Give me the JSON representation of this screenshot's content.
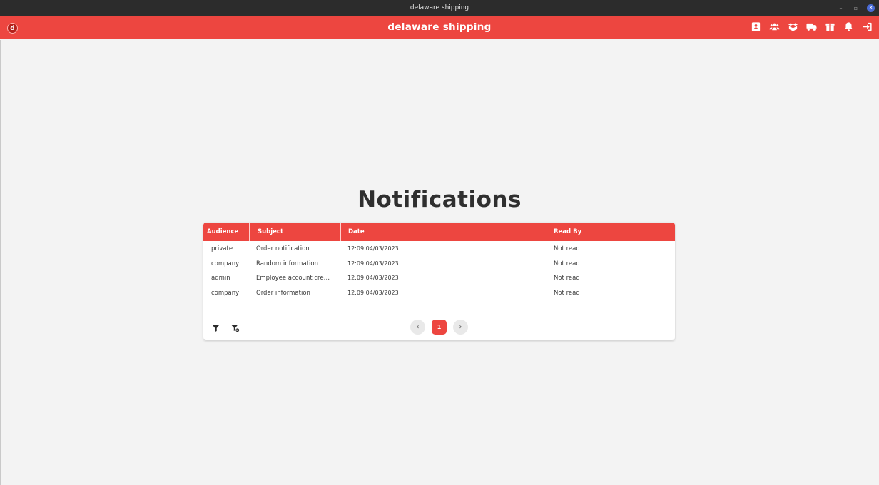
{
  "window": {
    "title": "delaware shipping"
  },
  "app": {
    "logo_letter": "d",
    "title": "delaware shipping",
    "header_icons": [
      "contact-card-icon",
      "users-icon",
      "boxes-icon",
      "truck-icon",
      "package-icon",
      "bell-icon",
      "logout-icon"
    ],
    "accent_color": "#ed4640"
  },
  "page": {
    "title": "Notifications"
  },
  "table": {
    "columns": [
      "Audience",
      "Subject",
      "Date",
      "Read By"
    ],
    "rows": [
      {
        "audience": "private",
        "subject": "Order notification",
        "date": "12:09 04/03/2023",
        "read_by": "Not read"
      },
      {
        "audience": "company",
        "subject": "Random information",
        "date": "12:09 04/03/2023",
        "read_by": "Not read"
      },
      {
        "audience": "admin",
        "subject": "Employee account cre…",
        "date": "12:09 04/03/2023",
        "read_by": "Not read"
      },
      {
        "audience": "company",
        "subject": "Order information",
        "date": "12:09 04/03/2023",
        "read_by": "Not read"
      }
    ]
  },
  "pagination": {
    "prev": "‹",
    "current": "1",
    "next": "›"
  }
}
